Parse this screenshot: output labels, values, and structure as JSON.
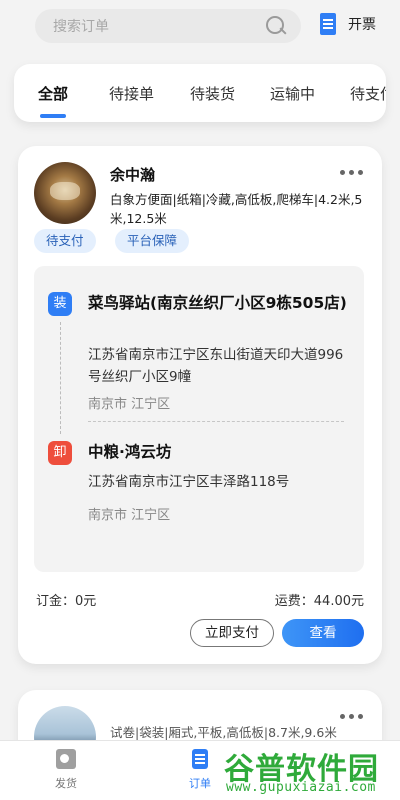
{
  "search": {
    "placeholder": "搜索订单"
  },
  "header": {
    "invoice_label": "开票",
    "invoice_icon": "invoice-icon"
  },
  "tabs": [
    {
      "label": "全部",
      "active": true
    },
    {
      "label": "待接单"
    },
    {
      "label": "待装货"
    },
    {
      "label": "运输中"
    },
    {
      "label": "待支付"
    }
  ],
  "orders": [
    {
      "shipper": "余中瀚",
      "cargo_desc": "白象方便面|纸箱|冷藏,高低板,爬梯车|4.2米,5米,12.5米",
      "badges": [
        "待支付",
        "平台保障"
      ],
      "load": {
        "tag": "装",
        "name": "菜鸟驿站(南京丝织厂小区9栋505店)",
        "address": "江苏省南京市江宁区东山街道天印大道996号丝织厂小区9幢",
        "city": "南京市 江宁区"
      },
      "unload": {
        "tag": "卸",
        "name": "中粮·鸿云坊",
        "address": "江苏省南京市江宁区丰泽路118号",
        "city": "南京市 江宁区"
      },
      "deposit": "订金：0元",
      "freight": "运费：44.00元",
      "actions": {
        "pay_label": "立即支付",
        "view_label": "查看"
      }
    },
    {
      "cargo_desc": "试卷|袋装|厢式,平板,高低板|8.7米,9.6米"
    }
  ],
  "bottom_nav": [
    {
      "label": "发货",
      "icon": "truck-icon"
    },
    {
      "label": "订单",
      "icon": "order-icon",
      "active": true
    }
  ],
  "watermark": {
    "title": "谷普软件园",
    "url": "www.gupuxiazai.com"
  },
  "colors": {
    "accent": "#2f7ef5",
    "unload_tag": "#ee4e3c",
    "badge_bg": "#e4effd",
    "watermark": "#2faa3a"
  }
}
